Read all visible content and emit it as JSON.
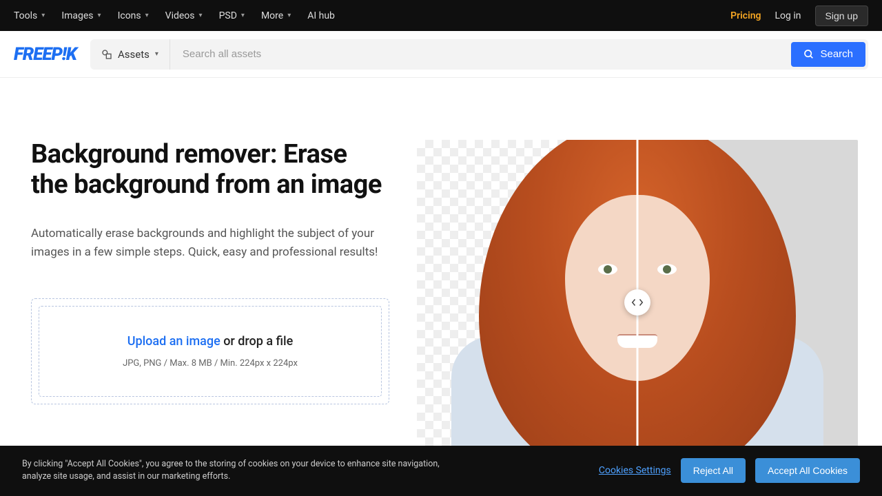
{
  "topnav": {
    "items": [
      "Tools",
      "Images",
      "Icons",
      "Videos",
      "PSD",
      "More"
    ],
    "aihub": "AI hub",
    "pricing": "Pricing",
    "login": "Log in",
    "signup": "Sign up"
  },
  "brand": "FREEP!K",
  "search": {
    "dropdown": "Assets",
    "placeholder": "Search all assets",
    "button": "Search"
  },
  "hero": {
    "title": "Background remover: Erase the background from an image",
    "desc": "Automatically erase backgrounds and highlight the subject of your images in a few simple steps. Quick, easy and professional results!",
    "upload_link": "Upload an image",
    "upload_rest": " or drop a file",
    "upload_sub": "JPG, PNG / Max. 8 MB / Min. 224px x 224px"
  },
  "cookie": {
    "text": "By clicking \"Accept All Cookies\", you agree to the storing of cookies on your device to enhance site navigation, analyze site usage, and assist in our marketing efforts.",
    "settings": "Cookies Settings",
    "reject": "Reject All",
    "accept": "Accept All Cookies"
  }
}
